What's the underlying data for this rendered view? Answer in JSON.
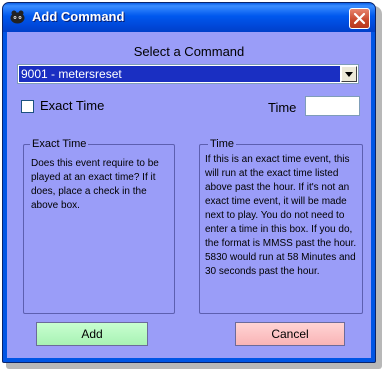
{
  "window": {
    "title": "Add Command",
    "icon": "app-icon",
    "close_icon": "close-icon"
  },
  "command": {
    "section_label": "Select a Command",
    "selected": "9001 - metersreset"
  },
  "exact_time": {
    "label": "Exact Time",
    "checked": false
  },
  "time": {
    "label": "Time",
    "value": ""
  },
  "help_exact_time": {
    "title": "Exact Time",
    "text": "Does this event require to be played at an exact time?  If it does, place a check in the above box."
  },
  "help_time": {
    "title": "Time",
    "text": "If this is an exact time event, this will run at the exact time listed above past the hour.  If it's not an exact time event, it will be made next to play.  You do not need to enter a time in this box.  If you do, the format is MMSS past the hour.  5830 would run at 58 Minutes and 30 seconds past the hour."
  },
  "buttons": {
    "add": "Add",
    "cancel": "Cancel"
  },
  "colors": {
    "titlebar": "#0055e5",
    "client": "#9a9df8",
    "selection": "#1a2fc2",
    "add_button": "#b8f7c2",
    "cancel_button": "#fcc4c6",
    "close_button": "#c7462b"
  }
}
